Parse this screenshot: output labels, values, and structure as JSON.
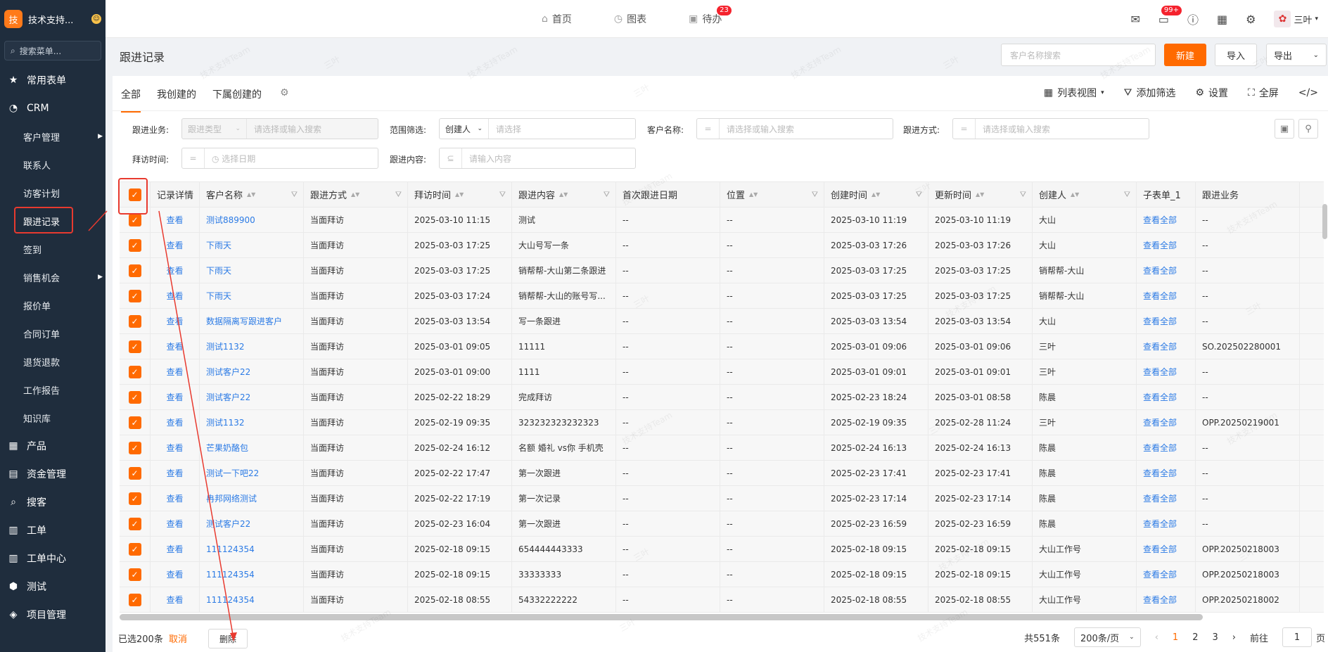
{
  "sidebar": {
    "logo_char": "技",
    "app_title": "技术支持...",
    "search_placeholder": "搜索菜单...",
    "items": [
      {
        "label": "常用表单",
        "icon": "star-icon"
      },
      {
        "label": "CRM",
        "icon": "crm-icon"
      }
    ],
    "crm_sub": [
      {
        "label": "客户管理",
        "arrow": true
      },
      {
        "label": "联系人",
        "arrow": false
      },
      {
        "label": "访客计划",
        "arrow": false
      },
      {
        "label": "跟进记录",
        "arrow": false,
        "active": true
      },
      {
        "label": "签到",
        "arrow": false
      },
      {
        "label": "销售机会",
        "arrow": true
      },
      {
        "label": "报价单",
        "arrow": false
      },
      {
        "label": "合同订单",
        "arrow": false
      },
      {
        "label": "退货退款",
        "arrow": false
      },
      {
        "label": "工作报告",
        "arrow": false
      },
      {
        "label": "知识库",
        "arrow": false
      }
    ],
    "bottom_items": [
      {
        "label": "产品",
        "icon": "grid-icon"
      },
      {
        "label": "资金管理",
        "icon": "money-icon"
      },
      {
        "label": "搜客",
        "icon": "search-icon"
      },
      {
        "label": "工单",
        "icon": "clipboard-icon"
      },
      {
        "label": "工单中心",
        "icon": "clipboard-icon"
      },
      {
        "label": "测试",
        "icon": "tag-icon"
      },
      {
        "label": "项目管理",
        "icon": "layers-icon"
      }
    ]
  },
  "topnav": {
    "tabs": [
      {
        "label": "首页",
        "icon": "home-icon"
      },
      {
        "label": "图表",
        "icon": "chart-icon"
      },
      {
        "label": "待办",
        "icon": "calendar-icon",
        "badge": "23"
      }
    ],
    "message_badge": "99+",
    "user_name": "三叶"
  },
  "header": {
    "title": "跟进记录",
    "search_placeholder": "客户名称搜索",
    "new_label": "新建",
    "import_label": "导入",
    "export_label": "导出"
  },
  "view_tabs": [
    "全部",
    "我创建的",
    "下属创建的"
  ],
  "tools": {
    "list_view": "列表视图",
    "add_filter": "添加筛选",
    "settings": "设置",
    "fullscreen": "全屏"
  },
  "filters": {
    "biz_label": "跟进业务:",
    "biz_type_ph": "跟进类型",
    "biz_search_ph": "请选择或输入搜索",
    "scope_label": "范围筛选:",
    "scope_value": "创建人",
    "scope_ph": "请选择",
    "customer_label": "客户名称:",
    "customer_op": "=",
    "customer_ph": "请选择或输入搜索",
    "method_label": "跟进方式:",
    "method_op": "=",
    "method_ph": "请选择或输入搜索",
    "visit_label": "拜访时间:",
    "visit_op": "=",
    "visit_ph": "选择日期",
    "content_label": "跟进内容:",
    "content_op": "⊆",
    "content_ph": "请输入内容"
  },
  "table": {
    "columns": [
      "记录详情",
      "客户名称",
      "跟进方式",
      "拜访时间",
      "跟进内容",
      "首次跟进日期",
      "位置",
      "创建时间",
      "更新时间",
      "创建人",
      "子表单_1",
      "跟进业务"
    ],
    "rows": [
      [
        "查看",
        "测试889900",
        "当面拜访",
        "2025-03-10 11:15",
        "测试",
        "--",
        "--",
        "2025-03-10 11:19",
        "2025-03-10 11:19",
        "大山",
        "查看全部",
        "--"
      ],
      [
        "查看",
        "下雨天",
        "当面拜访",
        "2025-03-03 17:25",
        "大山号写一条",
        "--",
        "--",
        "2025-03-03 17:26",
        "2025-03-03 17:26",
        "大山",
        "查看全部",
        "--"
      ],
      [
        "查看",
        "下雨天",
        "当面拜访",
        "2025-03-03 17:25",
        "销帮帮-大山第二条跟进",
        "--",
        "--",
        "2025-03-03 17:25",
        "2025-03-03 17:25",
        "销帮帮-大山",
        "查看全部",
        "--"
      ],
      [
        "查看",
        "下雨天",
        "当面拜访",
        "2025-03-03 17:24",
        "销帮帮-大山的账号写...",
        "--",
        "--",
        "2025-03-03 17:25",
        "2025-03-03 17:25",
        "销帮帮-大山",
        "查看全部",
        "--"
      ],
      [
        "查看",
        "数据隔离写跟进客户",
        "当面拜访",
        "2025-03-03 13:54",
        "写一条跟进",
        "--",
        "--",
        "2025-03-03 13:54",
        "2025-03-03 13:54",
        "大山",
        "查看全部",
        "--"
      ],
      [
        "查看",
        "测试1132",
        "当面拜访",
        "2025-03-01 09:05",
        "11111",
        "--",
        "--",
        "2025-03-01 09:06",
        "2025-03-01 09:06",
        "三叶",
        "查看全部",
        "SO.202502280001"
      ],
      [
        "查看",
        "测试客户22",
        "当面拜访",
        "2025-03-01 09:00",
        "1111",
        "--",
        "--",
        "2025-03-01 09:01",
        "2025-03-01 09:01",
        "三叶",
        "查看全部",
        "--"
      ],
      [
        "查看",
        "测试客户22",
        "当面拜访",
        "2025-02-22 18:29",
        "完成拜访",
        "--",
        "--",
        "2025-02-23 18:24",
        "2025-03-01 08:58",
        "陈晨",
        "查看全部",
        "--"
      ],
      [
        "查看",
        "测试1132",
        "当面拜访",
        "2025-02-19 09:35",
        "323232323232323",
        "--",
        "--",
        "2025-02-19 09:35",
        "2025-02-28 11:24",
        "三叶",
        "查看全部",
        "OPP.20250219001"
      ],
      [
        "查看",
        "芒果奶酪包",
        "当面拜访",
        "2025-02-24 16:12",
        "名额 婚礼 vs你 手机壳",
        "--",
        "--",
        "2025-02-24 16:13",
        "2025-02-24 16:13",
        "陈晨",
        "查看全部",
        "--"
      ],
      [
        "查看",
        "测试一下吧22",
        "当面拜访",
        "2025-02-22 17:47",
        "第一次跟进",
        "--",
        "--",
        "2025-02-23 17:41",
        "2025-02-23 17:41",
        "陈晨",
        "查看全部",
        "--"
      ],
      [
        "查看",
        "冉邦网络测试",
        "当面拜访",
        "2025-02-22 17:19",
        "第一次记录",
        "--",
        "--",
        "2025-02-23 17:14",
        "2025-02-23 17:14",
        "陈晨",
        "查看全部",
        "--"
      ],
      [
        "查看",
        "测试客户22",
        "当面拜访",
        "2025-02-23 16:04",
        "第一次跟进",
        "--",
        "--",
        "2025-02-23 16:59",
        "2025-02-23 16:59",
        "陈晨",
        "查看全部",
        "--"
      ],
      [
        "查看",
        "111124354",
        "当面拜访",
        "2025-02-18 09:15",
        "654444443333",
        "--",
        "--",
        "2025-02-18 09:15",
        "2025-02-18 09:15",
        "大山工作号",
        "查看全部",
        "OPP.20250218003"
      ],
      [
        "查看",
        "111124354",
        "当面拜访",
        "2025-02-18 09:15",
        "33333333",
        "--",
        "--",
        "2025-02-18 09:15",
        "2025-02-18 09:15",
        "大山工作号",
        "查看全部",
        "OPP.20250218003"
      ],
      [
        "查看",
        "111124354",
        "当面拜访",
        "2025-02-18 08:55",
        "54332222222",
        "--",
        "--",
        "2025-02-18 08:55",
        "2025-02-18 08:55",
        "大山工作号",
        "查看全部",
        "OPP.20250218002"
      ]
    ]
  },
  "footer": {
    "selected": "已选200条",
    "cancel": "取消",
    "delete": "删除",
    "total": "共551条",
    "page_size": "200条/页",
    "pages": [
      "1",
      "2",
      "3"
    ],
    "goto_label": "前往",
    "goto_value": "1",
    "page_suffix": "页"
  },
  "watermark": [
    "技术支持Team",
    "三叶"
  ],
  "colors": {
    "accent": "#ff6a00",
    "link": "#2c7be5",
    "sidebar": "#1f2d3d",
    "highlight": "#e83a2f"
  }
}
